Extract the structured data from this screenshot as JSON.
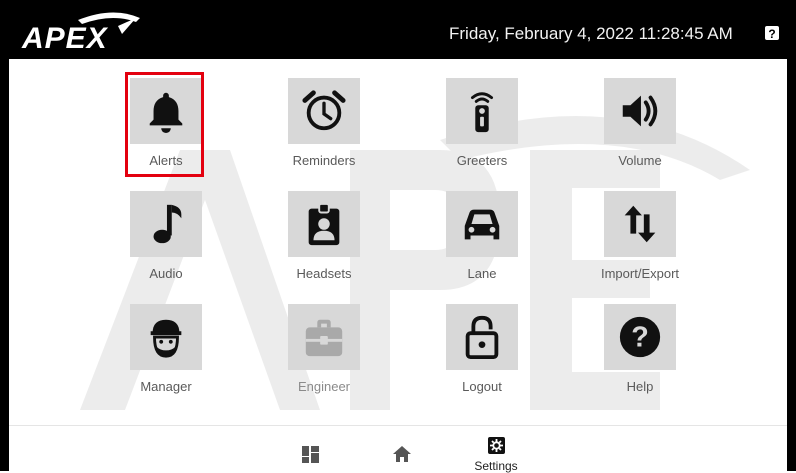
{
  "header": {
    "logo_text": "APEX",
    "datetime": "Friday, February 4, 2022 11:28:45 AM",
    "help_icon": "question-square-icon"
  },
  "tiles": [
    {
      "label": "Alerts",
      "icon": "bell-icon",
      "selected": true
    },
    {
      "label": "Reminders",
      "icon": "alarm-clock-icon"
    },
    {
      "label": "Greeters",
      "icon": "remote-control-icon"
    },
    {
      "label": "Volume",
      "icon": "speaker-icon"
    },
    {
      "label": "Audio",
      "icon": "music-note-icon"
    },
    {
      "label": "Headsets",
      "icon": "id-badge-icon"
    },
    {
      "label": "Lane",
      "icon": "car-icon"
    },
    {
      "label": "Import/Export",
      "icon": "up-down-arrows-icon"
    },
    {
      "label": "Manager",
      "icon": "manager-icon"
    },
    {
      "label": "Engineer",
      "icon": "toolbox-icon",
      "disabled": true
    },
    {
      "label": "Logout",
      "icon": "padlock-icon"
    },
    {
      "label": "Help",
      "icon": "question-circle-icon"
    }
  ],
  "nav": {
    "dashboard_icon": "dashboard-icon",
    "home_icon": "home-icon",
    "settings_icon": "gear-icon",
    "settings_label": "Settings"
  },
  "colors": {
    "header_bg": "#000000",
    "tile_bg": "#d8d8d8",
    "highlight": "#e3000f",
    "icon": "#111111"
  }
}
